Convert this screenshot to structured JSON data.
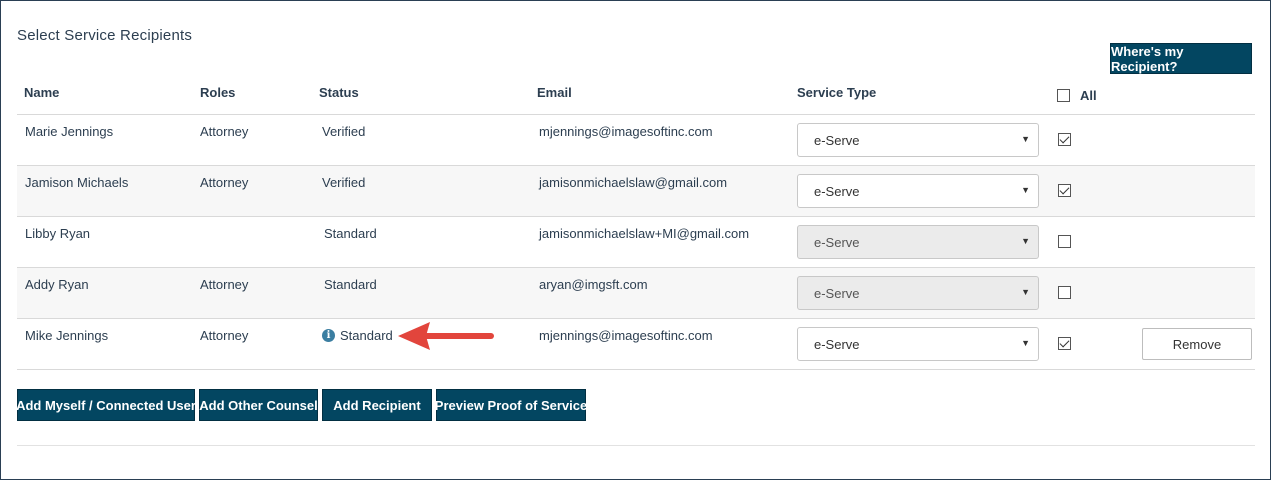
{
  "section_title": "Select Service Recipients",
  "help_button": "Where's my Recipient?",
  "columns": {
    "name": "Name",
    "roles": "Roles",
    "status": "Status",
    "email": "Email",
    "service_type": "Service Type",
    "all": "All"
  },
  "select_all_checked": false,
  "rows": [
    {
      "name": "Marie Jennings",
      "role": "Attorney",
      "status": "Verified",
      "email": "mjennings@imagesoftinc.com",
      "service_type": "e-Serve",
      "disabled": false,
      "checked": true
    },
    {
      "name": "Jamison Michaels",
      "role": "Attorney",
      "status": "Verified",
      "email": "jamisonmichaelslaw@gmail.com",
      "service_type": "e-Serve",
      "disabled": false,
      "checked": true
    },
    {
      "name": "Libby Ryan",
      "role": "",
      "status": "Standard",
      "email": "jamisonmichaelslaw+MI@gmail.com",
      "service_type": "e-Serve",
      "disabled": true,
      "checked": false
    },
    {
      "name": "Addy Ryan",
      "role": "Attorney",
      "status": "Standard",
      "email": "aryan@imgsft.com",
      "service_type": "e-Serve",
      "disabled": true,
      "checked": false
    },
    {
      "name": "Mike Jennings",
      "role": "Attorney",
      "status": "Standard",
      "email": "mjennings@imagesoftinc.com",
      "service_type": "e-Serve",
      "disabled": false,
      "checked": true,
      "info_icon": "info-circle-icon",
      "remove_label": "Remove"
    }
  ],
  "actions": {
    "add_myself": "Add Myself / Connected User",
    "add_other_counsel": "Add Other Counsel",
    "add_recipient": "Add Recipient",
    "preview_proof": "Preview Proof of Service"
  },
  "colors": {
    "primary_button": "#034661",
    "annotation_arrow": "#e2453c",
    "info_icon": "#3b7ea1"
  }
}
